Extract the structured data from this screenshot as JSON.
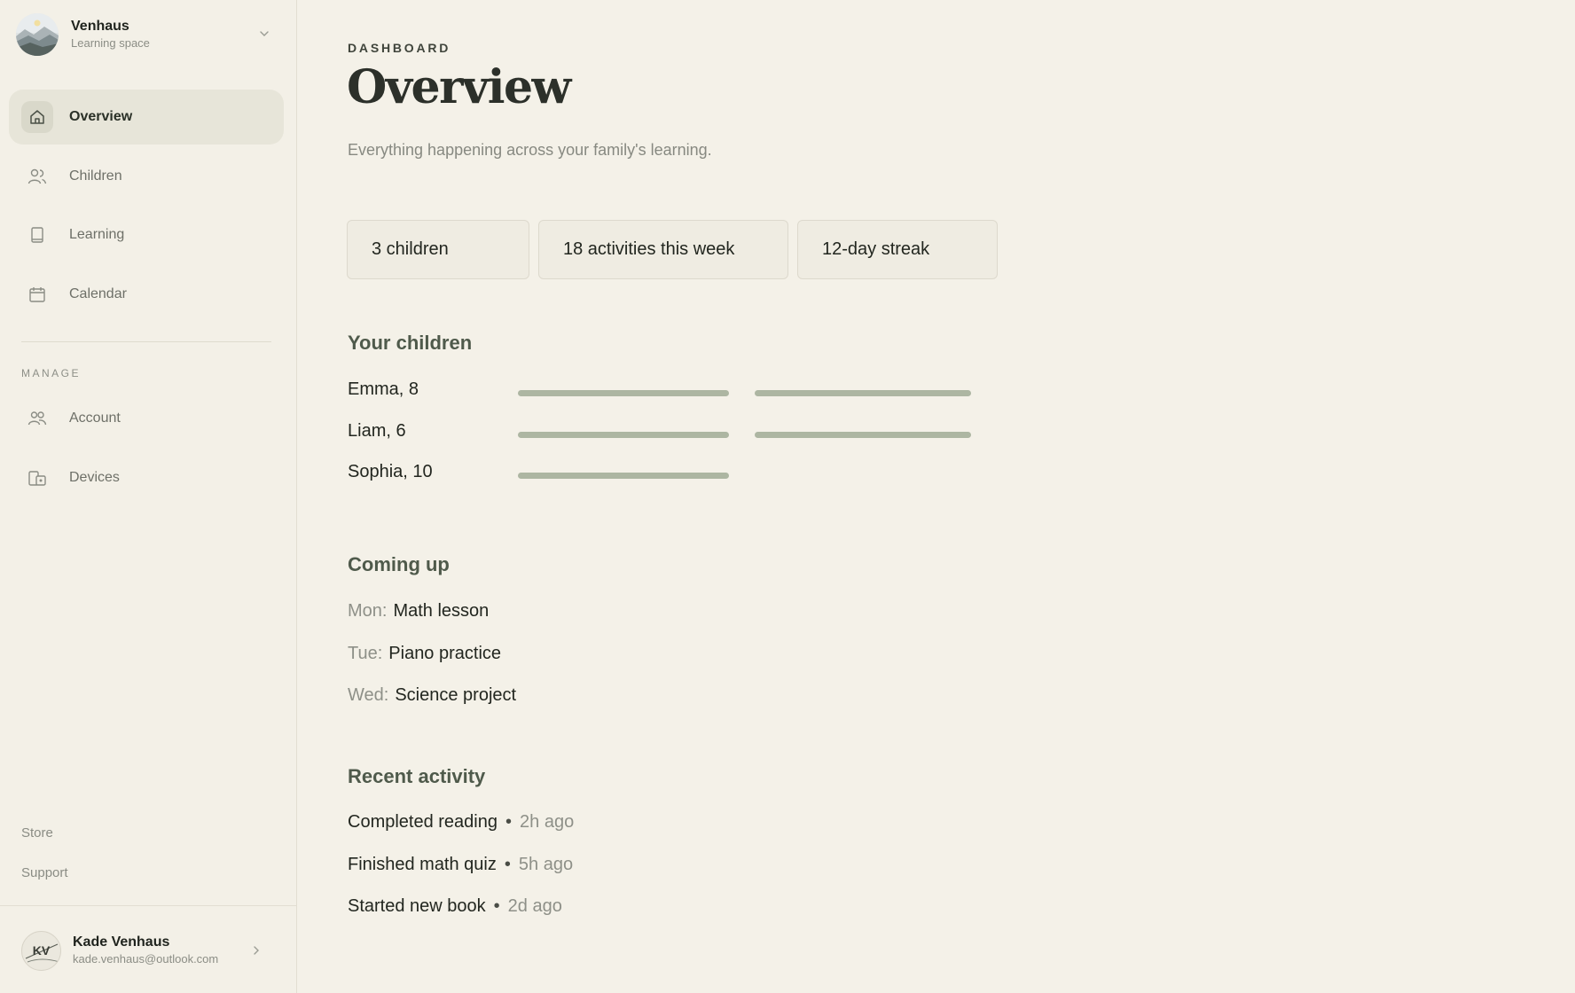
{
  "workspace": {
    "name": "Venhaus",
    "subtitle": "Learning space"
  },
  "nav": [
    {
      "label": "Overview",
      "icon": "home-icon",
      "active": true
    },
    {
      "label": "Children",
      "icon": "users-icon"
    },
    {
      "label": "Learning",
      "icon": "book-icon"
    },
    {
      "label": "Calendar",
      "icon": "calendar-icon"
    }
  ],
  "manage": {
    "label": "MANAGE",
    "items": [
      {
        "label": "Account",
        "icon": "account-icon"
      },
      {
        "label": "Devices",
        "icon": "devices-icon"
      }
    ]
  },
  "footer_links": [
    "Store",
    "Support"
  ],
  "user": {
    "initials": "KV",
    "name": "Kade Venhaus",
    "email": "kade.venhaus@outlook.com"
  },
  "header": {
    "eyebrow": "DASHBOARD",
    "title": "Overview",
    "subtitle": "Everything happening across your family's learning."
  },
  "stats": [
    "3 children",
    "18 activities this week",
    "12-day streak"
  ],
  "sections": {
    "children": "Your children",
    "coming_up": "Coming up",
    "recent": "Recent activity"
  },
  "children": [
    {
      "name": "Emma, 8",
      "bars": 2
    },
    {
      "name": "Liam, 6",
      "bars": 2
    },
    {
      "name": "Sophia, 10",
      "bars": 1
    }
  ],
  "coming_up": [
    {
      "day": "Mon:",
      "event": "Math lesson"
    },
    {
      "day": "Tue:",
      "event": "Piano practice"
    },
    {
      "day": "Wed:",
      "event": "Science project"
    }
  ],
  "recent_activity": [
    {
      "text": "Completed reading",
      "ago": "2h ago"
    },
    {
      "text": "Finished math quiz",
      "ago": "5h ago"
    },
    {
      "text": "Started new book",
      "ago": "2d ago"
    }
  ],
  "colors": {
    "background": "#f4f1e8",
    "accent": "#adb6a2",
    "active_nav": "#e7e5d9"
  }
}
